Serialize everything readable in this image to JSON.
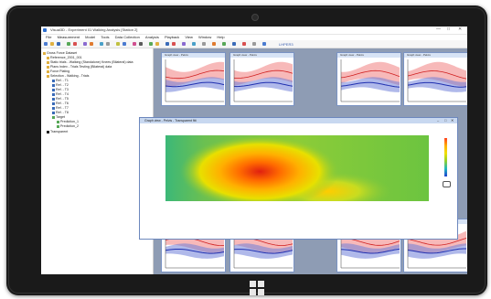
{
  "window": {
    "title": "Visual3D - Experiment 01 Walking Analysis [Station 2]",
    "controls": [
      "—",
      "□",
      "✕"
    ]
  },
  "menu": [
    "File",
    "Measurement",
    "Model",
    "Tools",
    "Data Collection",
    "Analysis",
    "Playback",
    "View",
    "Window",
    "Help"
  ],
  "toolbar": {
    "field_value": "LHPER3",
    "icons": [
      "new-icon",
      "open-icon",
      "save-icon",
      "undo-icon",
      "redo-icon",
      "play-icon",
      "stop-icon",
      "zoom-icon"
    ]
  },
  "tree": {
    "items": [
      {
        "label": "Gross Force Dataset",
        "indent": 0
      },
      {
        "label": "Reference_2001_001",
        "indent": 1
      },
      {
        "label": "Static trials - Walking (Standalone) Knees (Bilateral) data",
        "indent": 1
      },
      {
        "label": "Plans Index - Trials Testing (Bilateral) data",
        "indent": 1
      },
      {
        "label": "Force Plating",
        "indent": 1
      },
      {
        "label": "Selection - Walking - Trials",
        "indent": 1
      },
      {
        "label": "Ref. - T1",
        "indent": 2
      },
      {
        "label": "Ref. - T2",
        "indent": 2
      },
      {
        "label": "Ref. - T3",
        "indent": 2
      },
      {
        "label": "Ref. - T4",
        "indent": 2
      },
      {
        "label": "Ref. - T5",
        "indent": 2
      },
      {
        "label": "Ref. - T6",
        "indent": 2
      },
      {
        "label": "Ref. - T7",
        "indent": 2
      },
      {
        "label": "Ref. - T8",
        "indent": 2
      },
      {
        "label": "Target",
        "indent": 2
      },
      {
        "label": "Prediction_1",
        "indent": 3
      },
      {
        "label": "Prediction_2",
        "indent": 3
      },
      {
        "label": "Transparent",
        "indent": 1
      }
    ]
  },
  "plots": {
    "title": "Graph view - Pelvis"
  },
  "heatmap": {
    "title": "Graph view - Pelvis - Transparent fitt"
  },
  "colors": {
    "accent": "#3b5fb0",
    "band_red": "#f08080",
    "band_blue": "#7080d8"
  }
}
